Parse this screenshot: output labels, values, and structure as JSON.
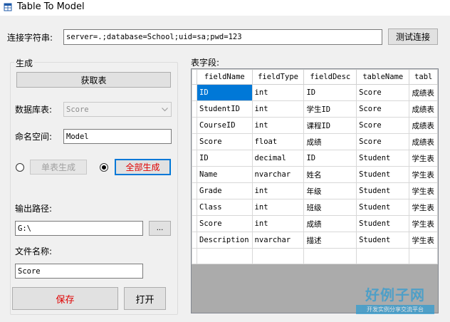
{
  "window": {
    "title": "Table To Model"
  },
  "connection": {
    "label": "连接字符串:",
    "value": "server=.;database=School;uid=sa;pwd=123",
    "test_button": "测试连接"
  },
  "generate": {
    "group_title": "生成",
    "fetch_button": "获取表",
    "database_label": "数据库表:",
    "database_value": "Score",
    "namespace_label": "命名空间:",
    "namespace_value": "Model",
    "single_button": "单表生成",
    "all_button": "全部生成",
    "output_label": "输出路径:",
    "output_value": "G:\\",
    "browse_button": "...",
    "filename_label": "文件名称:",
    "filename_value": "Score",
    "save_button": "保存",
    "open_button": "打开"
  },
  "fields": {
    "label": "表字段:",
    "columns": [
      "fieldName",
      "fieldType",
      "fieldDesc",
      "tableName",
      "tabl"
    ],
    "rows": [
      [
        "ID",
        "int",
        "ID",
        "Score",
        "成绩表"
      ],
      [
        "StudentID",
        "int",
        "学生ID",
        "Score",
        "成绩表"
      ],
      [
        "CourseID",
        "int",
        "课程ID",
        "Score",
        "成绩表"
      ],
      [
        "Score",
        "float",
        "成绩",
        "Score",
        "成绩表"
      ],
      [
        "ID",
        "decimal",
        "ID",
        "Student",
        "学生表"
      ],
      [
        "Name",
        "nvarchar",
        "姓名",
        "Student",
        "学生表"
      ],
      [
        "Grade",
        "int",
        "年级",
        "Student",
        "学生表"
      ],
      [
        "Class",
        "int",
        "班级",
        "Student",
        "学生表"
      ],
      [
        "Score",
        "int",
        "成绩",
        "Student",
        "学生表"
      ],
      [
        "Description",
        "nvarchar",
        "描述",
        "Student",
        "学生表"
      ]
    ]
  },
  "watermark": {
    "main": "好例子网",
    "sub": "开发实例分享交流平台"
  }
}
